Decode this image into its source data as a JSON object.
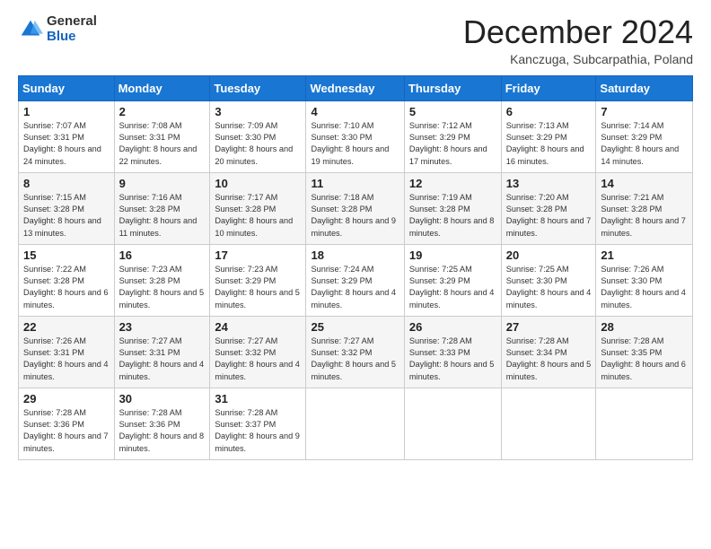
{
  "logo": {
    "general": "General",
    "blue": "Blue"
  },
  "title": "December 2024",
  "subtitle": "Kanczuga, Subcarpathia, Poland",
  "days_header": [
    "Sunday",
    "Monday",
    "Tuesday",
    "Wednesday",
    "Thursday",
    "Friday",
    "Saturday"
  ],
  "weeks": [
    [
      {
        "day": "1",
        "sunrise": "7:07 AM",
        "sunset": "3:31 PM",
        "daylight": "8 hours and 24 minutes."
      },
      {
        "day": "2",
        "sunrise": "7:08 AM",
        "sunset": "3:31 PM",
        "daylight": "8 hours and 22 minutes."
      },
      {
        "day": "3",
        "sunrise": "7:09 AM",
        "sunset": "3:30 PM",
        "daylight": "8 hours and 20 minutes."
      },
      {
        "day": "4",
        "sunrise": "7:10 AM",
        "sunset": "3:30 PM",
        "daylight": "8 hours and 19 minutes."
      },
      {
        "day": "5",
        "sunrise": "7:12 AM",
        "sunset": "3:29 PM",
        "daylight": "8 hours and 17 minutes."
      },
      {
        "day": "6",
        "sunrise": "7:13 AM",
        "sunset": "3:29 PM",
        "daylight": "8 hours and 16 minutes."
      },
      {
        "day": "7",
        "sunrise": "7:14 AM",
        "sunset": "3:29 PM",
        "daylight": "8 hours and 14 minutes."
      }
    ],
    [
      {
        "day": "8",
        "sunrise": "7:15 AM",
        "sunset": "3:28 PM",
        "daylight": "8 hours and 13 minutes."
      },
      {
        "day": "9",
        "sunrise": "7:16 AM",
        "sunset": "3:28 PM",
        "daylight": "8 hours and 11 minutes."
      },
      {
        "day": "10",
        "sunrise": "7:17 AM",
        "sunset": "3:28 PM",
        "daylight": "8 hours and 10 minutes."
      },
      {
        "day": "11",
        "sunrise": "7:18 AM",
        "sunset": "3:28 PM",
        "daylight": "8 hours and 9 minutes."
      },
      {
        "day": "12",
        "sunrise": "7:19 AM",
        "sunset": "3:28 PM",
        "daylight": "8 hours and 8 minutes."
      },
      {
        "day": "13",
        "sunrise": "7:20 AM",
        "sunset": "3:28 PM",
        "daylight": "8 hours and 7 minutes."
      },
      {
        "day": "14",
        "sunrise": "7:21 AM",
        "sunset": "3:28 PM",
        "daylight": "8 hours and 7 minutes."
      }
    ],
    [
      {
        "day": "15",
        "sunrise": "7:22 AM",
        "sunset": "3:28 PM",
        "daylight": "8 hours and 6 minutes."
      },
      {
        "day": "16",
        "sunrise": "7:23 AM",
        "sunset": "3:28 PM",
        "daylight": "8 hours and 5 minutes."
      },
      {
        "day": "17",
        "sunrise": "7:23 AM",
        "sunset": "3:29 PM",
        "daylight": "8 hours and 5 minutes."
      },
      {
        "day": "18",
        "sunrise": "7:24 AM",
        "sunset": "3:29 PM",
        "daylight": "8 hours and 4 minutes."
      },
      {
        "day": "19",
        "sunrise": "7:25 AM",
        "sunset": "3:29 PM",
        "daylight": "8 hours and 4 minutes."
      },
      {
        "day": "20",
        "sunrise": "7:25 AM",
        "sunset": "3:30 PM",
        "daylight": "8 hours and 4 minutes."
      },
      {
        "day": "21",
        "sunrise": "7:26 AM",
        "sunset": "3:30 PM",
        "daylight": "8 hours and 4 minutes."
      }
    ],
    [
      {
        "day": "22",
        "sunrise": "7:26 AM",
        "sunset": "3:31 PM",
        "daylight": "8 hours and 4 minutes."
      },
      {
        "day": "23",
        "sunrise": "7:27 AM",
        "sunset": "3:31 PM",
        "daylight": "8 hours and 4 minutes."
      },
      {
        "day": "24",
        "sunrise": "7:27 AM",
        "sunset": "3:32 PM",
        "daylight": "8 hours and 4 minutes."
      },
      {
        "day": "25",
        "sunrise": "7:27 AM",
        "sunset": "3:32 PM",
        "daylight": "8 hours and 5 minutes."
      },
      {
        "day": "26",
        "sunrise": "7:28 AM",
        "sunset": "3:33 PM",
        "daylight": "8 hours and 5 minutes."
      },
      {
        "day": "27",
        "sunrise": "7:28 AM",
        "sunset": "3:34 PM",
        "daylight": "8 hours and 5 minutes."
      },
      {
        "day": "28",
        "sunrise": "7:28 AM",
        "sunset": "3:35 PM",
        "daylight": "8 hours and 6 minutes."
      }
    ],
    [
      {
        "day": "29",
        "sunrise": "7:28 AM",
        "sunset": "3:36 PM",
        "daylight": "8 hours and 7 minutes."
      },
      {
        "day": "30",
        "sunrise": "7:28 AM",
        "sunset": "3:36 PM",
        "daylight": "8 hours and 8 minutes."
      },
      {
        "day": "31",
        "sunrise": "7:28 AM",
        "sunset": "3:37 PM",
        "daylight": "8 hours and 9 minutes."
      },
      null,
      null,
      null,
      null
    ]
  ],
  "labels": {
    "sunrise": "Sunrise: ",
    "sunset": "Sunset: ",
    "daylight": "Daylight: "
  }
}
